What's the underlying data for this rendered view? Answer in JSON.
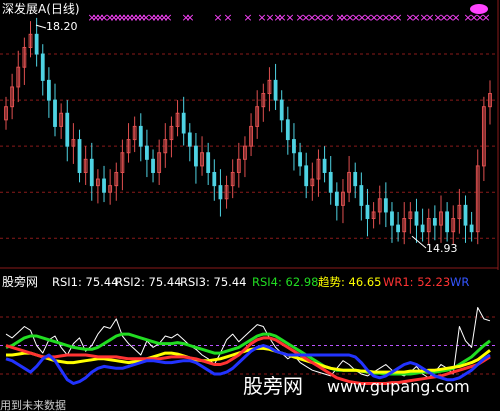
{
  "panel": {
    "title": "深发展A(日线)",
    "max_label": "18.20",
    "min_label": "14.93"
  },
  "indicator": {
    "name": "股旁网",
    "items": [
      {
        "key": "rsi1",
        "text": "RSI1: 75.44",
        "color": "#ffffff"
      },
      {
        "key": "rsi2",
        "text": "RSI2: 75.44",
        "color": "#ffffff"
      },
      {
        "key": "rsi3",
        "text": "RSI3: 75.44",
        "color": "#ffffff"
      },
      {
        "key": "rsi4",
        "text": "RSI4: 62.98",
        "color": "#22dd22"
      },
      {
        "key": "trend",
        "text": "趋势: 46.65",
        "color": "#ffff00"
      },
      {
        "key": "wr1",
        "text": "WR1: 52.23",
        "color": "#ff3333"
      },
      {
        "key": "wr",
        "text": "WR",
        "color": "#3355ff"
      }
    ]
  },
  "watermark": {
    "site": "股旁网",
    "url": "www.gupang.com",
    "bottom_left": "用到未来数据"
  },
  "colors": {
    "up": "#e05050",
    "down": "#4fd3e3",
    "grid": "#8a1a1a",
    "markers": "#ff44ff",
    "white": "#ffffff",
    "green": "#22dd22",
    "yellow": "#ffff00",
    "red": "#ff2222",
    "blue": "#2233ff"
  },
  "chart_data": [
    {
      "type": "candlestick",
      "title": "深发展A(日线)",
      "ylim": [
        14.6,
        18.4
      ],
      "annotations": [
        {
          "text": "18.20",
          "value": 18.2
        },
        {
          "text": "14.93",
          "value": 14.93
        }
      ],
      "closes": [
        16.9,
        17.2,
        17.5,
        17.8,
        18.0,
        17.7,
        17.3,
        17.0,
        16.6,
        16.8,
        16.3,
        16.4,
        15.9,
        16.1,
        15.7,
        15.8,
        15.6,
        15.7,
        15.9,
        16.2,
        16.4,
        16.6,
        16.3,
        16.1,
        15.9,
        16.2,
        16.4,
        16.6,
        16.8,
        16.5,
        16.3,
        16.0,
        16.2,
        15.9,
        15.7,
        15.5,
        15.7,
        15.9,
        16.1,
        16.3,
        16.6,
        16.9,
        17.1,
        17.3,
        17.0,
        16.7,
        16.4,
        16.2,
        16.0,
        15.7,
        15.8,
        16.1,
        15.9,
        15.6,
        15.4,
        15.6,
        15.9,
        15.7,
        15.4,
        15.2,
        15.3,
        15.5,
        15.3,
        15.1,
        15.0,
        15.2,
        15.3,
        15.1,
        15.0,
        15.2,
        15.1,
        15.3,
        15.0,
        15.2,
        15.4,
        15.1,
        15.0,
        16.0,
        16.9,
        17.1
      ]
    },
    {
      "type": "line",
      "name": "股旁网",
      "ylim": [
        0,
        100
      ],
      "series": [
        {
          "name": "RSI1",
          "color": "#ffffff",
          "values": [
            62,
            58,
            64,
            70,
            66,
            50,
            42,
            56,
            60,
            48,
            40,
            52,
            58,
            44,
            50,
            62,
            70,
            68,
            78,
            60,
            52,
            46,
            40,
            55,
            48,
            52,
            60,
            58,
            62,
            56,
            50,
            46,
            40,
            36,
            30,
            42,
            56,
            62,
            54,
            60,
            66,
            72,
            70,
            58,
            48,
            42,
            36,
            40,
            32,
            28,
            24,
            22,
            20,
            18,
            26,
            34,
            30,
            24,
            20,
            18,
            22,
            26,
            30,
            24,
            20,
            18,
            22,
            28,
            20,
            16,
            22,
            30,
            26,
            20,
            70,
            55,
            48,
            90,
            78,
            76
          ]
        },
        {
          "name": "RSI4",
          "color": "#22dd22",
          "values": [
            48,
            50,
            54,
            58,
            60,
            60,
            58,
            56,
            54,
            52,
            50,
            48,
            47,
            46,
            46,
            48,
            52,
            56,
            60,
            62,
            62,
            60,
            58,
            56,
            54,
            52,
            52,
            52,
            53,
            52,
            50,
            48,
            46,
            44,
            42,
            42,
            44,
            46,
            48,
            52,
            56,
            60,
            62,
            62,
            60,
            56,
            52,
            48,
            44,
            40,
            36,
            32,
            28,
            26,
            24,
            24,
            24,
            24,
            23,
            22,
            21,
            21,
            20,
            20,
            20,
            20,
            20,
            21,
            22,
            22,
            22,
            23,
            24,
            26,
            30,
            34,
            38,
            44,
            50,
            55
          ]
        },
        {
          "name": "趋势",
          "color": "#ffff00",
          "values": [
            40,
            40,
            41,
            42,
            42,
            40,
            38,
            36,
            34,
            33,
            32,
            32,
            33,
            34,
            35,
            36,
            36,
            35,
            34,
            33,
            32,
            33,
            34,
            36,
            38,
            40,
            42,
            42,
            41,
            39,
            37,
            35,
            34,
            34,
            35,
            36,
            38,
            40,
            42,
            44,
            46,
            47,
            47,
            46,
            44,
            42,
            40,
            38,
            36,
            34,
            32,
            30,
            28,
            26,
            25,
            24,
            24,
            24,
            23,
            23,
            22,
            22,
            22,
            22,
            22,
            22,
            23,
            23,
            23,
            24,
            24,
            25,
            26,
            27,
            28,
            30,
            32,
            35,
            40,
            45
          ]
        },
        {
          "name": "WR1",
          "color": "#ff3333",
          "values": [
            50,
            48,
            46,
            44,
            42,
            40,
            38,
            38,
            38,
            39,
            40,
            40,
            40,
            40,
            39,
            38,
            38,
            38,
            38,
            37,
            36,
            36,
            36,
            36,
            36,
            36,
            37,
            38,
            38,
            38,
            37,
            36,
            34,
            32,
            30,
            30,
            32,
            36,
            40,
            46,
            52,
            56,
            58,
            58,
            56,
            52,
            48,
            44,
            40,
            36,
            32,
            28,
            24,
            20,
            16,
            14,
            12,
            11,
            10,
            10,
            10,
            10,
            10,
            11,
            11,
            12,
            13,
            14,
            15,
            16,
            17,
            18,
            20,
            22,
            24,
            26,
            28,
            30,
            34,
            38
          ]
        },
        {
          "name": "WR",
          "color": "#2233ff",
          "values": [
            36,
            34,
            30,
            26,
            22,
            28,
            36,
            40,
            34,
            24,
            14,
            10,
            12,
            16,
            22,
            26,
            28,
            27,
            26,
            26,
            28,
            30,
            32,
            34,
            34,
            33,
            32,
            32,
            33,
            34,
            34,
            32,
            28,
            24,
            20,
            20,
            22,
            26,
            32,
            38,
            44,
            48,
            50,
            48,
            44,
            42,
            40,
            40,
            40,
            40,
            40,
            40,
            40,
            40,
            40,
            40,
            40,
            38,
            32,
            24,
            18,
            16,
            18,
            22,
            26,
            30,
            32,
            30,
            26,
            22,
            18,
            16,
            14,
            14,
            16,
            20,
            24,
            30,
            36,
            40
          ]
        }
      ]
    }
  ]
}
